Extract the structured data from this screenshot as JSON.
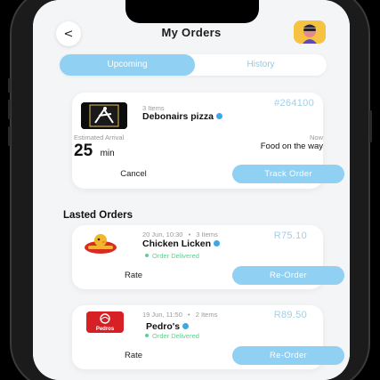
{
  "header": {
    "title": "My Orders",
    "back_icon": "chevron-left-icon",
    "back_symbol": "<",
    "avatar_icon": "user-avatar-icon"
  },
  "tabs": [
    {
      "label": "Upcoming",
      "active": true
    },
    {
      "label": "History",
      "active": false
    }
  ],
  "current_order": {
    "items_count": "3 Items",
    "restaurant": "Debonairs pizza",
    "order_number": "#264100",
    "eta_label": "Estimated Arrival",
    "eta_value": "25",
    "eta_unit": "min",
    "status_label": "Now",
    "status_value": "Food on the way",
    "cancel_label": "Cancel",
    "track_label": "Track Order"
  },
  "latest_orders": {
    "title": "Lasted Orders",
    "orders": [
      {
        "date_time": "20 Jun, 10:30",
        "items_count": "3 Items",
        "restaurant": "Chicken Licken",
        "price": "R75.10",
        "status": "Order Delivered",
        "rate_label": "Rate",
        "reorder_label": "Re-Order"
      },
      {
        "date_time": "19 Jun, 11:50",
        "items_count": "2 Items",
        "restaurant": "Pedro's",
        "price": "R89.50",
        "status": "Order Delivered",
        "rate_label": "Rate",
        "reorder_label": "Re-Order"
      }
    ]
  },
  "logos": {
    "debonairs": "Debonairs logo",
    "chicken_licken": "Chicken Licken logo",
    "pedros": "Pedros"
  },
  "colors": {
    "accent": "#8fd0f3",
    "delivered": "#5fcf8f",
    "price": "#9fd0ea"
  }
}
